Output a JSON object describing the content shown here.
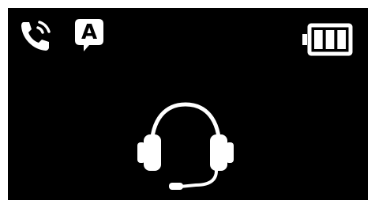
{
  "device_screen": {
    "background_color": "#000000",
    "foreground_color": "#ffffff",
    "status_bar": {
      "call_icon": "phone-call-icon",
      "assist_icon": "assist-message-icon",
      "assist_letter": "A",
      "battery_icon": "battery-full-icon",
      "battery_level_bars": 3,
      "battery_level_max": 3
    },
    "main": {
      "mode_icon": "headset-icon"
    }
  }
}
